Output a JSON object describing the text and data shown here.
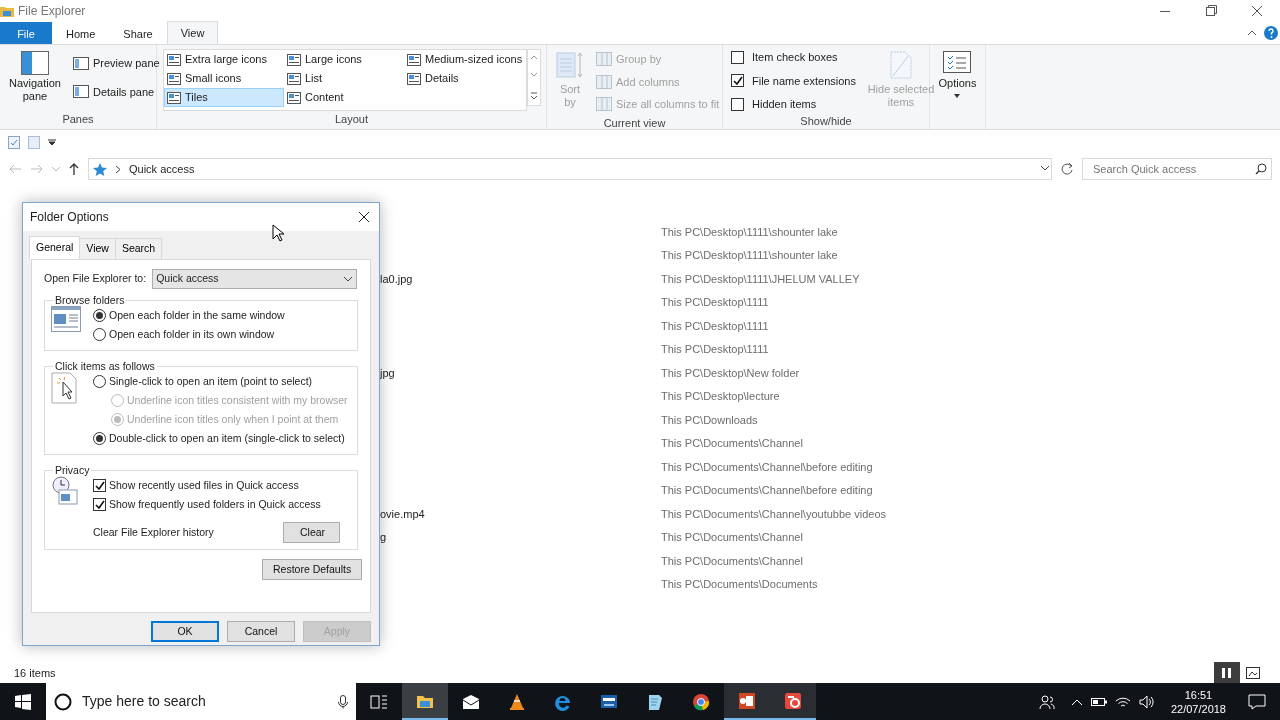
{
  "window": {
    "title": "File Explorer"
  },
  "ribbon_tabs": [
    {
      "label": "File",
      "kind": "file",
      "selected": false
    },
    {
      "label": "Home",
      "kind": "tab",
      "selected": false
    },
    {
      "label": "Share",
      "kind": "tab",
      "selected": false
    },
    {
      "label": "View",
      "kind": "tab",
      "selected": true
    }
  ],
  "ribbon": {
    "panes": {
      "label": "Panes",
      "navigation": "Navigation pane",
      "items": [
        "Preview pane",
        "Details pane"
      ]
    },
    "layout": {
      "label": "Layout",
      "items": [
        {
          "label": "Extra large icons",
          "selected": false
        },
        {
          "label": "Large icons",
          "selected": false
        },
        {
          "label": "Medium-sized icons",
          "selected": false
        },
        {
          "label": "Small icons",
          "selected": false
        },
        {
          "label": "List",
          "selected": false
        },
        {
          "label": "Details",
          "selected": false
        },
        {
          "label": "Tiles",
          "selected": true
        },
        {
          "label": "Content",
          "selected": false
        }
      ]
    },
    "current_view": {
      "label": "Current view",
      "sort": "Sort by",
      "items": [
        "Group by",
        "Add columns",
        "Size all columns to fit"
      ]
    },
    "show_hide": {
      "label": "Show/hide",
      "checkboxes": [
        {
          "label": "Item check boxes",
          "checked": false
        },
        {
          "label": "File name extensions",
          "checked": true
        },
        {
          "label": "Hidden items",
          "checked": false
        }
      ],
      "hide_selected": "Hide selected items"
    },
    "options": "Options"
  },
  "address": {
    "path": "Quick access",
    "search_placeholder": "Search Quick access"
  },
  "files": [
    {
      "location": "This PC\\Desktop\\1111\\shounter lake"
    },
    {
      "location": "This PC\\Desktop\\1111\\shounter lake"
    },
    {
      "name": "la0.jpg",
      "location": "This PC\\Desktop\\1111\\JHELUM VALLEY"
    },
    {
      "location": "This PC\\Desktop\\1111"
    },
    {
      "location": "This PC\\Desktop\\1111"
    },
    {
      "location": "This PC\\Desktop\\1111"
    },
    {
      "name": "jpg",
      "location": "This PC\\Desktop\\New folder"
    },
    {
      "location": "This PC\\Desktop\\lecture"
    },
    {
      "location": "This PC\\Downloads"
    },
    {
      "location": "This PC\\Documents\\Channel"
    },
    {
      "location": "This PC\\Documents\\Channel\\before editing"
    },
    {
      "location": "This PC\\Documents\\Channel\\before editing"
    },
    {
      "name": "ovie.mp4",
      "location": "This PC\\Documents\\Channel\\youtubbe videos"
    },
    {
      "name": "g",
      "location": "This PC\\Documents\\Channel"
    },
    {
      "location": "This PC\\Documents\\Channel"
    },
    {
      "location": "This PC\\Documents\\Documents"
    }
  ],
  "status_bar": {
    "count": "16 items"
  },
  "dialog": {
    "title": "Folder Options",
    "tabs": [
      {
        "label": "General",
        "selected": true
      },
      {
        "label": "View",
        "selected": false
      },
      {
        "label": "Search",
        "selected": false
      }
    ],
    "open_to": {
      "label": "Open File Explorer to:",
      "value": "Quick access"
    },
    "browse_folders": {
      "title": "Browse folders",
      "options": [
        {
          "label": "Open each folder in the same window",
          "selected": true,
          "disabled": false,
          "kind": "main"
        },
        {
          "label": "Open each folder in its own window",
          "selected": false,
          "disabled": false,
          "kind": "main"
        }
      ]
    },
    "click_items": {
      "title": "Click items as follows",
      "options": [
        {
          "label": "Single-click to open an item (point to select)",
          "selected": false,
          "disabled": false,
          "kind": "main"
        },
        {
          "label": "Underline icon titles consistent with my browser",
          "selected": false,
          "disabled": true,
          "kind": "sub"
        },
        {
          "label": "Underline icon titles only when I point at them",
          "selected": true,
          "disabled": true,
          "kind": "sub"
        },
        {
          "label": "Double-click to open an item (single-click to select)",
          "selected": true,
          "disabled": false,
          "kind": "main"
        }
      ]
    },
    "privacy": {
      "title": "Privacy",
      "checkboxes": [
        {
          "label": "Show recently used files in Quick access",
          "checked": true
        },
        {
          "label": "Show frequently used folders in Quick access",
          "checked": true
        }
      ],
      "clear_label": "Clear File Explorer history",
      "clear_button": "Clear"
    },
    "restore_button": "Restore Defaults",
    "buttons": [
      {
        "label": "OK",
        "kind": "default",
        "disabled": false
      },
      {
        "label": "Cancel",
        "kind": "normal",
        "disabled": false
      },
      {
        "label": "Apply",
        "kind": "normal",
        "disabled": true
      }
    ]
  },
  "taskbar": {
    "search_placeholder": "Type here to search",
    "time": "16:51",
    "date": "22/07/2018"
  }
}
